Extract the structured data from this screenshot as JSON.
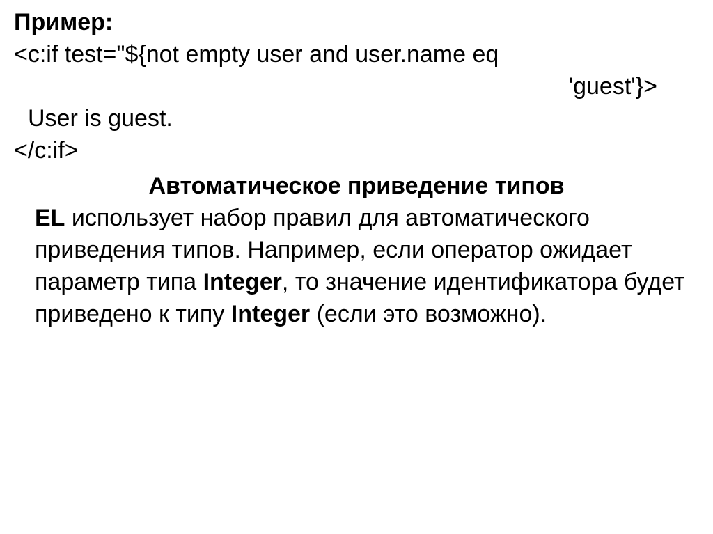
{
  "heading_example": "Пример:",
  "code": {
    "line1": "<c:if test=\"${not empty user and user.name eq",
    "line2": "'guest'}>",
    "line3": "User is guest.",
    "line4": "</c:if>"
  },
  "section_title": "Автоматическое приведение типов",
  "paragraph": {
    "el_label": "EL",
    "part1": " использует набор правил для автоматического приведения типов. Например, если оператор ожидает параметр типа ",
    "integer1": "Integer",
    "part2": ", то значение идентификатора будет приведено к типу ",
    "integer2": "Integer",
    "part3": " (если это возможно)."
  }
}
